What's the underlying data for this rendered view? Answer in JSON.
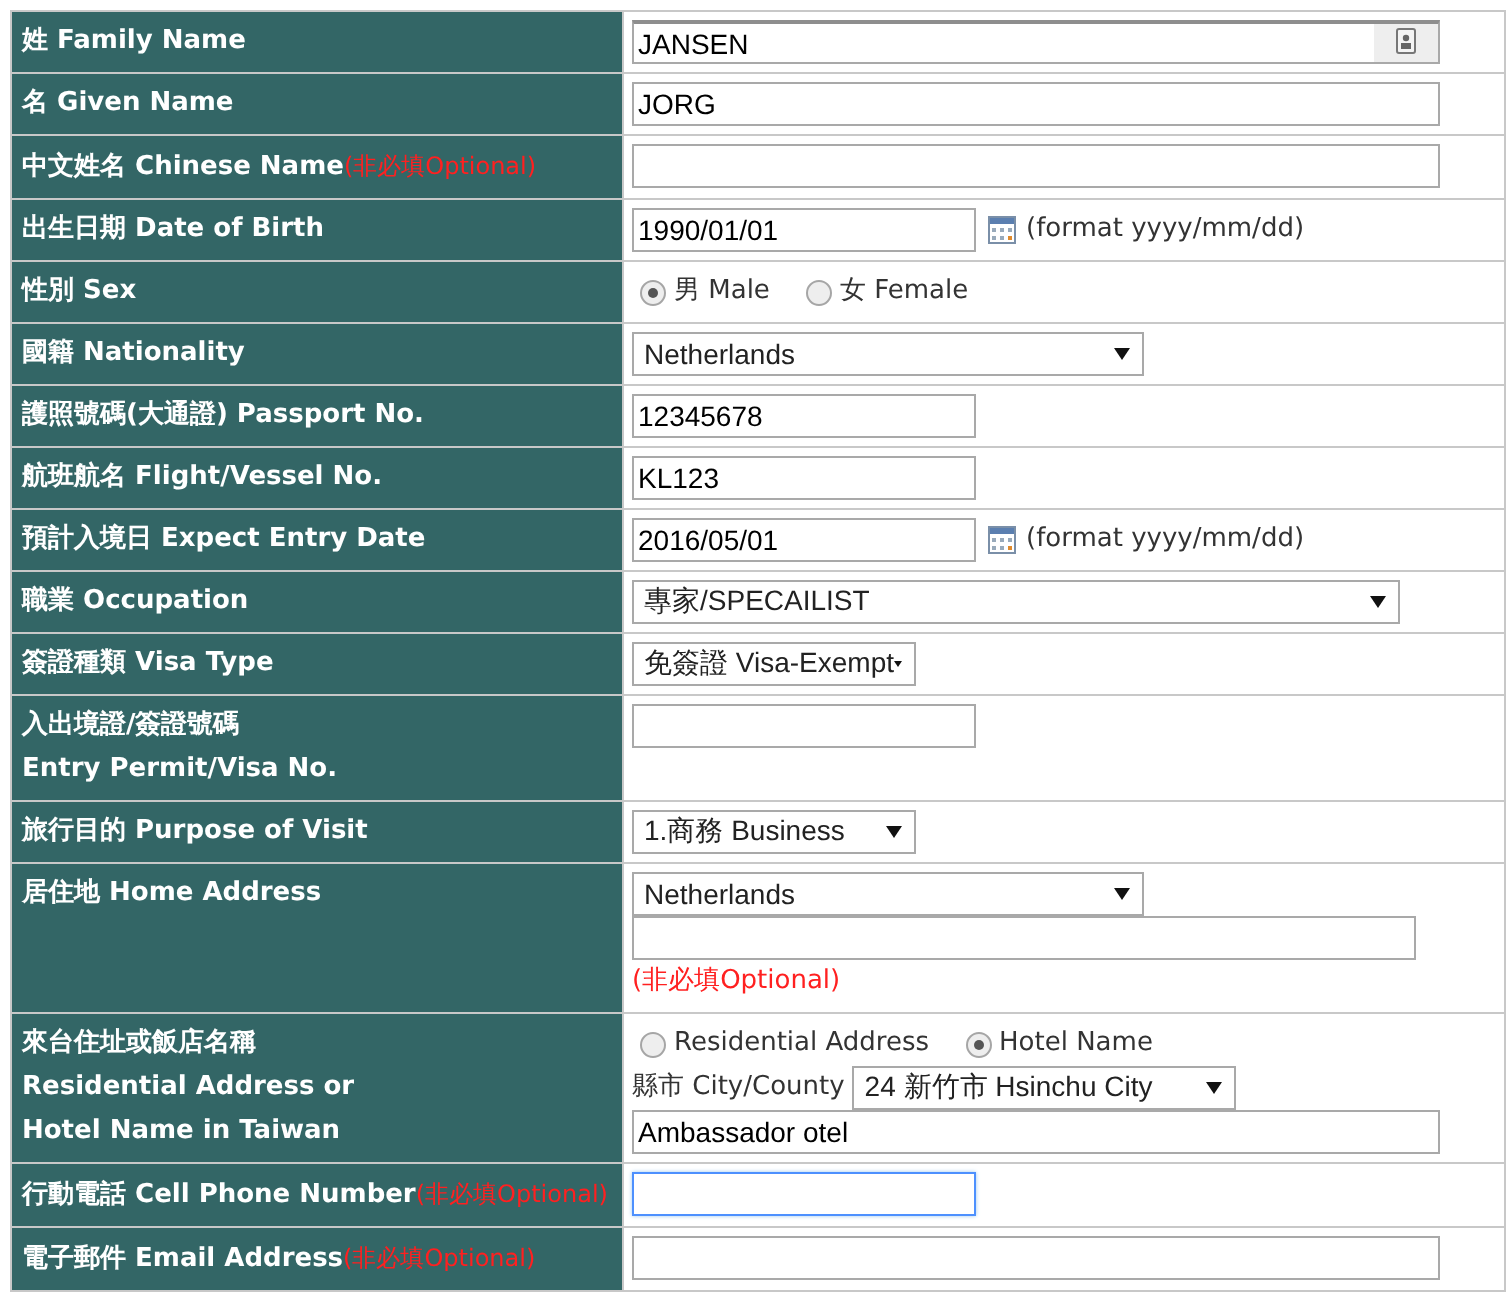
{
  "rows": [
    {
      "label": [
        "姓 Family Name"
      ],
      "controls": [
        {
          "kind": "text",
          "value": "JANSEN",
          "focused": false,
          "autofill": true
        }
      ]
    },
    {
      "label": [
        "名 Given Name"
      ],
      "controls": [
        {
          "kind": "text",
          "value": "JORG",
          "focused": false
        }
      ]
    },
    {
      "label": [
        "中文姓名 Chinese Name"
      ],
      "optional": "(非必填Optional)",
      "controls": [
        {
          "kind": "text",
          "focused": false
        }
      ]
    },
    {
      "label": [
        "出生日期 Date of Birth"
      ],
      "controls": [
        {
          "kind": "text",
          "value": "1990/01/01",
          "focused": false
        },
        {
          "kind": "calendar"
        },
        {
          "kind": "hint",
          "text": "(format yyyy/mm/dd)"
        }
      ]
    },
    {
      "label": [
        "性別 Sex"
      ],
      "controls": [
        {
          "kind": "radio",
          "text": "男 Male",
          "selected": true
        },
        {
          "kind": "radio",
          "text": "女 Female",
          "selected": false
        }
      ]
    },
    {
      "label": [
        "國籍 Nationality"
      ],
      "controls": [
        {
          "kind": "select",
          "value": "Netherlands"
        }
      ]
    },
    {
      "label": [
        "護照號碼(大通證) Passport No."
      ],
      "controls": [
        {
          "kind": "text",
          "value": "12345678",
          "focused": false
        }
      ]
    },
    {
      "label": [
        "航班航名 Flight/Vessel No."
      ],
      "controls": [
        {
          "kind": "text",
          "value": "KL123",
          "focused": false
        }
      ]
    },
    {
      "label": [
        "預計入境日 Expect Entry Date"
      ],
      "controls": [
        {
          "kind": "text",
          "value": "2016/05/01",
          "focused": false
        },
        {
          "kind": "calendar"
        },
        {
          "kind": "hint",
          "text": "(format yyyy/mm/dd)"
        }
      ]
    },
    {
      "label": [
        "職業 Occupation"
      ],
      "controls": [
        {
          "kind": "select",
          "value": "專家/SPECAILIST"
        }
      ]
    },
    {
      "label": [
        "簽證種類 Visa Type"
      ],
      "controls": [
        {
          "kind": "select",
          "value": "免簽證 Visa-Exempt"
        }
      ]
    },
    {
      "label": [
        "入出境證/簽證號碼",
        "Entry Permit/Visa No."
      ],
      "controls": [
        {
          "kind": "text",
          "focused": false
        }
      ]
    },
    {
      "label": [
        "旅行目的 Purpose of Visit"
      ],
      "controls": [
        {
          "kind": "select",
          "value": "1.商務 Business"
        }
      ]
    },
    {
      "label": [
        "居住地 Home Address"
      ],
      "controls": [
        {
          "kind": "select",
          "value": "Netherlands"
        },
        {
          "kind": "break"
        },
        {
          "kind": "text",
          "focused": false
        },
        {
          "kind": "break"
        },
        {
          "kind": "optional",
          "text": "(非必填Optional)"
        }
      ]
    },
    {
      "label": [
        "來台住址或飯店名稱",
        "Residential Address or",
        "Hotel Name in Taiwan"
      ],
      "controls": [
        {
          "kind": "radio",
          "text": "Residential Address",
          "selected": false
        },
        {
          "kind": "radio",
          "text": "Hotel Name",
          "selected": true
        },
        {
          "kind": "break"
        },
        {
          "kind": "caption",
          "text": "縣市 City/County"
        },
        {
          "kind": "select",
          "value": "24 新竹市 Hsinchu City"
        },
        {
          "kind": "break"
        },
        {
          "kind": "text",
          "value": "Ambassador otel",
          "focused": false
        }
      ]
    },
    {
      "label": [
        "行動電話 Cell Phone Number"
      ],
      "optional": "(非必填Optional)",
      "controls": [
        {
          "kind": "text",
          "focused": true
        }
      ]
    },
    {
      "label": [
        "電子郵件 Email Address"
      ],
      "optional": "(非必填Optional)",
      "controls": [
        {
          "kind": "text",
          "focused": false
        }
      ]
    }
  ]
}
